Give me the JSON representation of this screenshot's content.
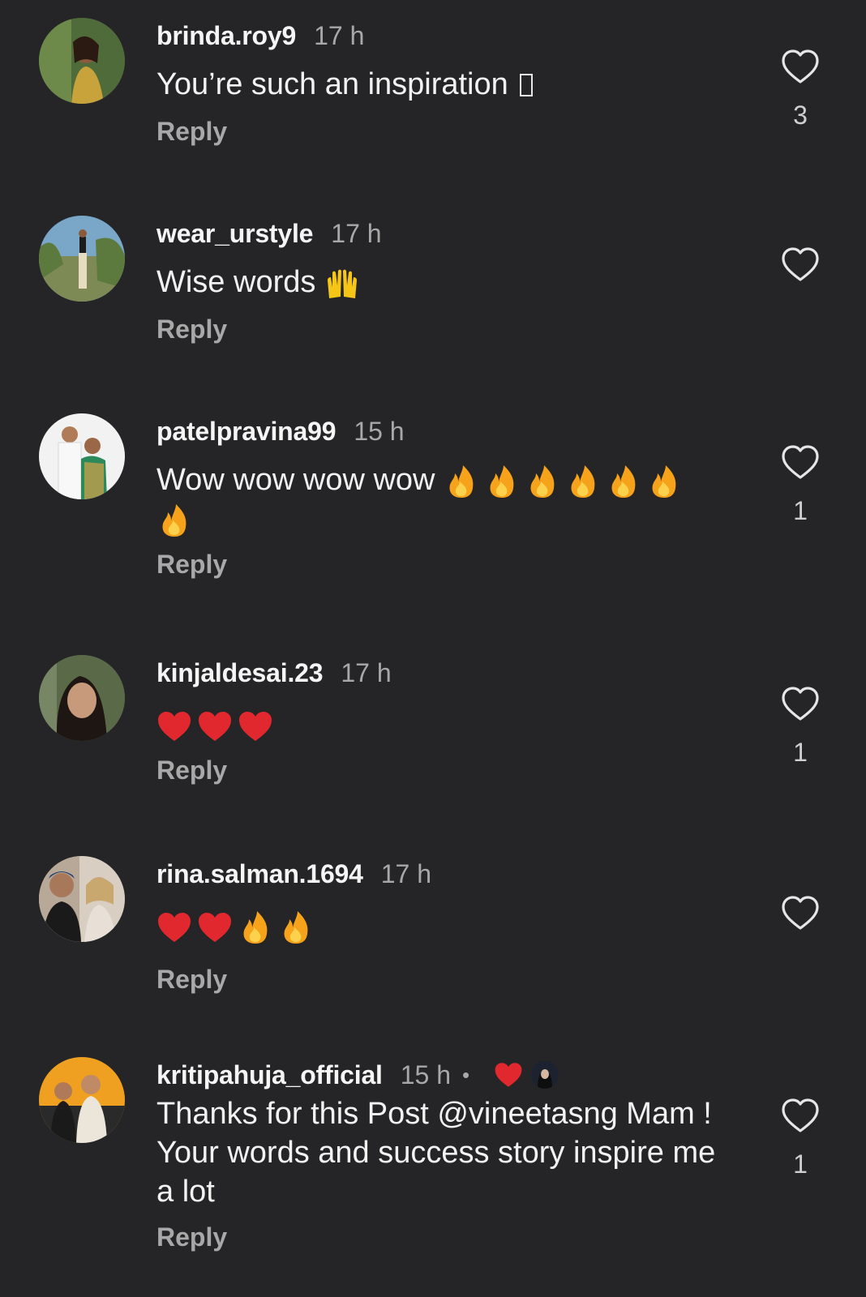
{
  "reply_label": "Reply",
  "colors": {
    "background": "#252527",
    "username": "#f5f5f5",
    "muted": "#a8a8a8",
    "heart_red": "#e0282e",
    "fire": "#f7a21b"
  },
  "comments": [
    {
      "username": "brinda.roy9",
      "time": "17 h",
      "text": "You’re such an inspiration",
      "trailing_glyph": "unrendered-emoji-box",
      "likes": "3"
    },
    {
      "username": "wear_urstyle",
      "time": "17 h",
      "text": "Wise words",
      "emojis": [
        "raising-hands"
      ],
      "likes": ""
    },
    {
      "username": "patelpravina99",
      "time": "15 h",
      "text": "Wow wow wow wow",
      "emojis": [
        "fire",
        "fire",
        "fire",
        "fire",
        "fire",
        "fire",
        "fire"
      ],
      "likes": "1"
    },
    {
      "username": "kinjaldesai.23",
      "time": "17 h",
      "text": "",
      "emojis": [
        "red-heart",
        "red-heart",
        "red-heart"
      ],
      "likes": "1"
    },
    {
      "username": "rina.salman.1694",
      "time": "17 h",
      "text": "",
      "emojis": [
        "red-heart",
        "red-heart",
        "fire",
        "fire"
      ],
      "likes": ""
    },
    {
      "username": "kritipahuja_official",
      "time": "15 h",
      "dot": "•",
      "liked_by_creator": true,
      "text": "Thanks for this Post @vineetasng Mam ! Your words and success story inspire me a lot",
      "likes": "1"
    }
  ]
}
